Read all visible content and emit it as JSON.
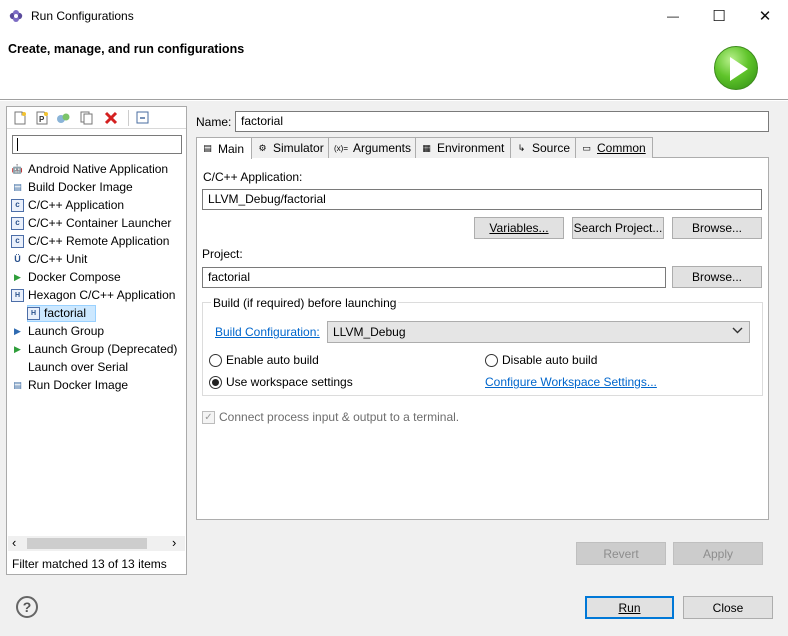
{
  "window": {
    "title": "Run Configurations",
    "minimize_glyph": "—",
    "maximize_glyph": "☐",
    "close_glyph": "✕"
  },
  "header": {
    "title": "Create, manage, and run configurations",
    "logo_icon": "run-icon"
  },
  "left_panel": {
    "toolbar_icons": [
      "new-configuration-icon",
      "new-prototype-icon",
      "export-icon",
      "duplicate-icon",
      "delete-icon",
      "collapse-all-icon"
    ],
    "filter_value": "",
    "tree": [
      {
        "label": "Android Native Application",
        "icon": "android-icon",
        "glyph": "🤖",
        "color": "#6a8a2a"
      },
      {
        "label": "Build Docker Image",
        "icon": "docker-build-icon",
        "glyph": "▤",
        "color": "#3a6aa0"
      },
      {
        "label": "C/C++ Application",
        "icon": "c-app-icon",
        "glyph": "c",
        "color": "#28508c"
      },
      {
        "label": "C/C++ Container Launcher",
        "icon": "c-container-icon",
        "glyph": "c",
        "color": "#28508c"
      },
      {
        "label": "C/C++ Remote Application",
        "icon": "c-remote-icon",
        "glyph": "c",
        "color": "#28508c"
      },
      {
        "label": "C/C++ Unit",
        "icon": "c-unit-icon",
        "glyph": "Ü",
        "color": "#28508c"
      },
      {
        "label": "Docker Compose",
        "icon": "docker-compose-icon",
        "glyph": "▶",
        "color": "#2e9e3a"
      },
      {
        "label": "Hexagon C/C++ Application",
        "icon": "hexagon-app-icon",
        "glyph": "H",
        "color": "#28508c"
      },
      {
        "label": "factorial",
        "icon": "hexagon-config-icon",
        "glyph": "H",
        "color": "#28508c",
        "child": true
      },
      {
        "label": "Launch Group",
        "icon": "launch-group-icon",
        "glyph": "▶",
        "color": "#2e6ab0"
      },
      {
        "label": "Launch Group (Deprecated)",
        "icon": "launch-group-deprecated-icon",
        "glyph": "▶",
        "color": "#2e9e3a"
      },
      {
        "label": "Launch over Serial",
        "icon": "serial-icon",
        "glyph": "",
        "color": "#999"
      },
      {
        "label": "Run Docker Image",
        "icon": "run-docker-icon",
        "glyph": "▤",
        "color": "#3a6aa0"
      }
    ],
    "scroll_left": "‹",
    "scroll_right": "›",
    "filter_status": "Filter matched 13 of 13 items"
  },
  "config": {
    "name_label": "Name:",
    "name_value": "factorial",
    "tabs": [
      {
        "label": "Main",
        "icon": "main-tab-icon",
        "glyph": "▤",
        "active": true
      },
      {
        "label": "Simulator",
        "icon": "simulator-tab-icon",
        "glyph": "⚙",
        "active": false
      },
      {
        "label": "Arguments",
        "icon": "arguments-tab-icon",
        "glyph": "(x)=",
        "active": false
      },
      {
        "label": "Environment",
        "icon": "environment-tab-icon",
        "glyph": "▦",
        "active": false
      },
      {
        "label": "Source",
        "icon": "source-tab-icon",
        "glyph": "↳",
        "active": false
      },
      {
        "label": "Common",
        "icon": "common-tab-icon",
        "glyph": "▭",
        "active": false
      }
    ],
    "main": {
      "app_label": "C/C++ Application:",
      "app_value": "LLVM_Debug/factorial",
      "variables_button": "Variables...",
      "search_project_button": "Search Project...",
      "browse_app_button": "Browse...",
      "project_label": "Project:",
      "project_value": "factorial",
      "browse_project_button": "Browse...",
      "build_group_title": "Build (if required) before launching",
      "build_config_link": "Build Configuration:",
      "build_config_value": "LLVM_Debug",
      "enable_auto_build": "Enable auto build",
      "disable_auto_build": "Disable auto build",
      "use_workspace_settings": "Use workspace settings",
      "configure_workspace_link": "Configure Workspace Settings...",
      "connect_terminal_label": "Connect process input & output to a terminal."
    },
    "revert_button": "Revert",
    "apply_button": "Apply"
  },
  "footer": {
    "help_glyph": "?",
    "run_button": "Run",
    "close_button": "Close"
  }
}
